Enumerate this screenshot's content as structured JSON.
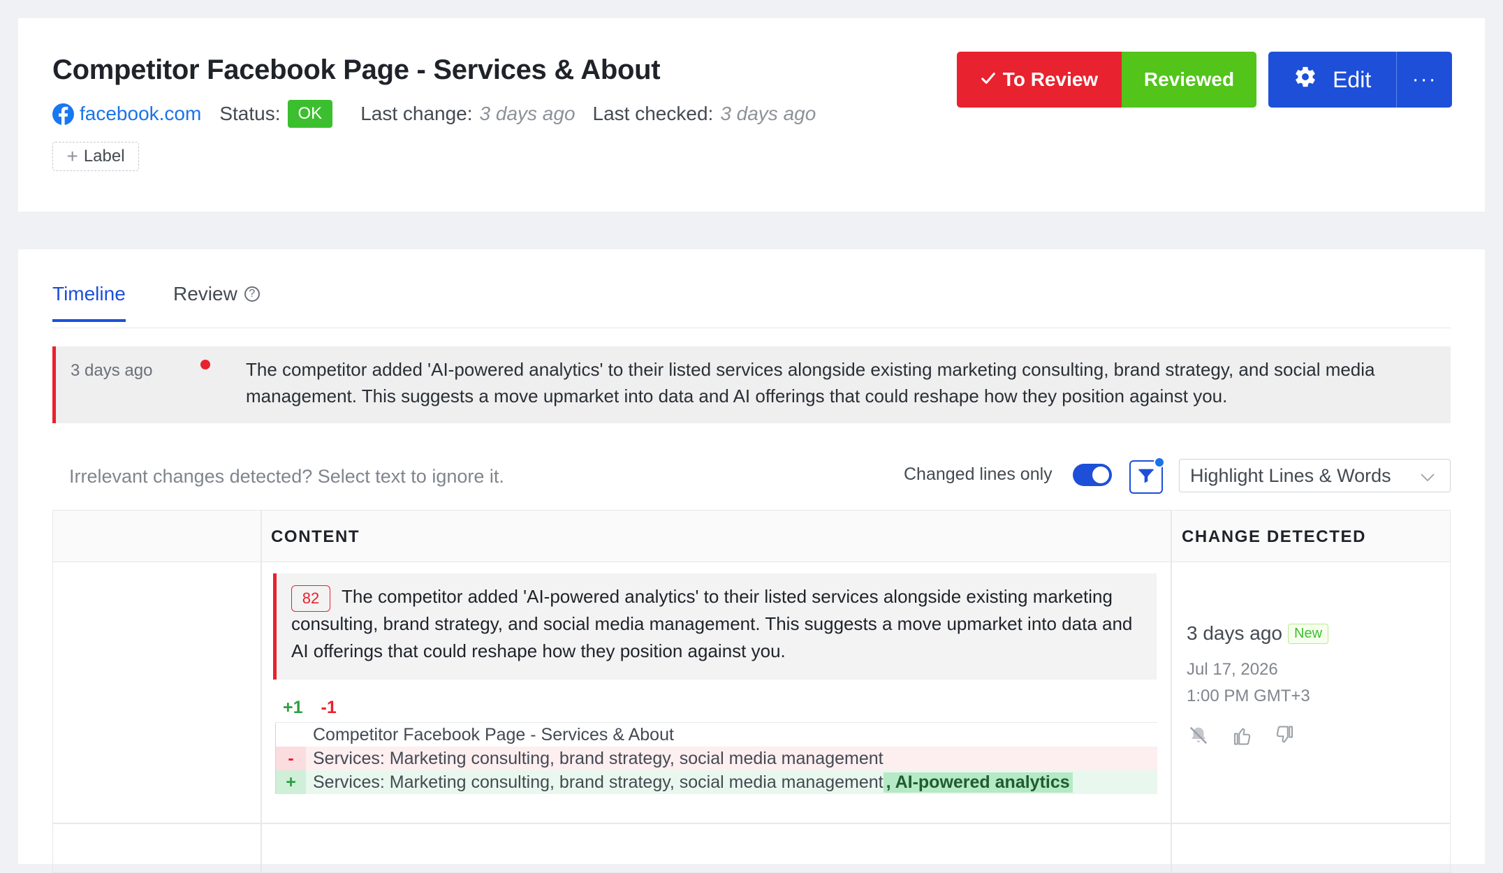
{
  "header": {
    "title": "Competitor Facebook Page - Services & About",
    "site_link": "facebook.com",
    "status_label": "Status:",
    "status_value": "OK",
    "last_change_label": "Last change:",
    "last_change_value": "3 days ago",
    "last_checked_label": "Last checked:",
    "last_checked_value": "3 days ago",
    "label_button": "Label",
    "to_review_button": "To Review",
    "reviewed_button": "Reviewed",
    "edit_button": "Edit",
    "more_button": "···"
  },
  "tabs": [
    {
      "label": "Timeline",
      "active": true
    },
    {
      "label": "Review",
      "active": false
    }
  ],
  "summary": {
    "time": "3 days ago",
    "text": "The competitor added 'AI-powered analytics' to their listed services alongside existing marketing consulting, brand strategy, and social media management. This suggests a move upmarket into data and AI offerings that could reshape how they position against you."
  },
  "toolbar": {
    "ignore_hint": "Irrelevant changes detected? Select text to ignore it.",
    "changed_lines_label": "Changed lines only",
    "changed_lines_on": true,
    "highlight_select_value": "Highlight Lines & Words"
  },
  "table": {
    "headers": {
      "empty": "",
      "content": "CONTENT",
      "change_detected": "CHANGE DETECTED"
    },
    "row": {
      "score": "82",
      "ai_text": "The competitor added 'AI-powered analytics' to their listed services alongside existing marketing consulting, brand strategy, and social media management. This suggests a move upmarket into data and AI offerings that could reshape how they position against you.",
      "added_count": "+1",
      "removed_count": "-1",
      "diff": {
        "context": "Competitor Facebook Page - Services & About",
        "removed": "Services: Marketing consulting, brand strategy, social media management",
        "added_prefix": "Services: Marketing consulting, brand strategy, social media management",
        "added_words": ", AI-powered analytics",
        "removed_marker": "-",
        "added_marker": "+"
      },
      "change_time": "3 days ago",
      "new_badge": "New",
      "change_date": "Jul 17, 2026",
      "change_clock": "1:00 PM GMT+3"
    }
  },
  "colors": {
    "accent_blue": "#1d4fd8",
    "alert_red": "#e8222e",
    "ok_green": "#3bbf2f",
    "reviewed_green": "#52c41a"
  }
}
